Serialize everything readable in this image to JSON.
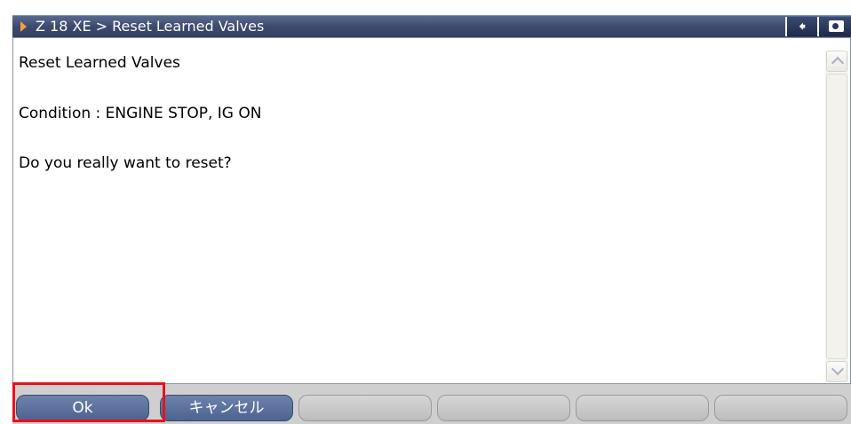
{
  "titlebar": {
    "title": "Z 18 XE > Reset Learned Valves",
    "back_icon": "arrow-left-icon",
    "camera_icon": "camera-icon"
  },
  "content": {
    "heading": "Reset Learned Valves",
    "condition": "Condition : ENGINE STOP, IG ON",
    "question": "Do you really want to reset?"
  },
  "buttons": {
    "ok": "Ok",
    "cancel": "キャンセル",
    "b3": "",
    "b4": "",
    "b5": "",
    "b6": ""
  },
  "colors": {
    "title_bg": "#3d4a6e",
    "active_button": "#5b6f9b",
    "highlight": "#e8121c",
    "arrow_accent": "#f0a040"
  }
}
